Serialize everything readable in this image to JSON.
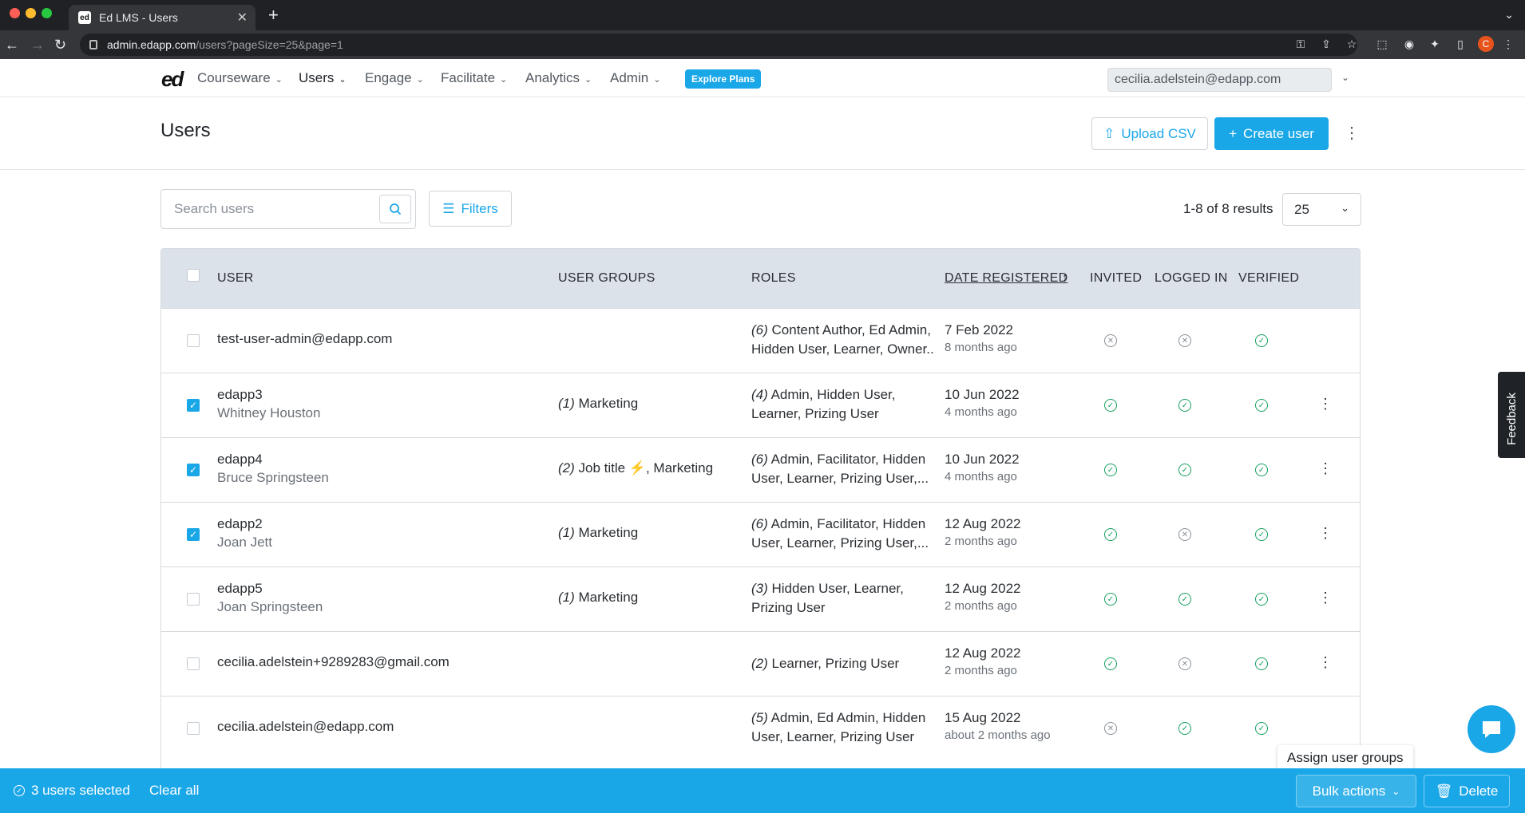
{
  "browser": {
    "tab_title": "Ed LMS - Users",
    "tab_favicon": "ed",
    "url_domain": "admin.edapp.com",
    "url_path": "/users?pageSize=25&page=1",
    "profile_initial": "C"
  },
  "nav": {
    "logo": "ed",
    "items": [
      {
        "label": "Courseware"
      },
      {
        "label": "Users"
      },
      {
        "label": "Engage"
      },
      {
        "label": "Facilitate"
      },
      {
        "label": "Analytics"
      },
      {
        "label": "Admin"
      }
    ],
    "explore_label": "Explore Plans",
    "account": "cecilia.adelstein@edapp.com"
  },
  "header": {
    "title": "Users",
    "upload_label": "Upload CSV",
    "create_label": "Create user"
  },
  "toolbar": {
    "search_placeholder": "Search users",
    "filters_label": "Filters",
    "results": "1-8 of 8 results",
    "page_size": "25"
  },
  "table": {
    "columns": [
      "USER",
      "USER GROUPS",
      "ROLES",
      "DATE REGISTERED",
      "INVITED",
      "LOGGED IN",
      "VERIFIED"
    ],
    "sort_arrow": "↑",
    "rows": [
      {
        "checked": false,
        "user": "test-user-admin@edapp.com",
        "name": "",
        "groups_count": "",
        "groups": "",
        "roles_count": "(6)",
        "roles_l1": " Content Author, Ed Admin,",
        "roles_l2": "Hidden User, Learner, Owner...",
        "date": "7 Feb 2022",
        "ago": "8 months ago",
        "invited": false,
        "logged_in": false,
        "verified": true,
        "menu": false
      },
      {
        "checked": true,
        "user": "edapp3",
        "name": "Whitney Houston",
        "groups_count": "(1)",
        "groups": " Marketing",
        "roles_count": "(4)",
        "roles_l1": " Admin, Hidden User,",
        "roles_l2": "Learner, Prizing User",
        "date": "10 Jun 2022",
        "ago": "4 months ago",
        "invited": true,
        "logged_in": true,
        "verified": true,
        "menu": true
      },
      {
        "checked": true,
        "user": "edapp4",
        "name": "Bruce Springsteen",
        "groups_count": "(2)",
        "groups": " Job title ⚡, Marketing",
        "roles_count": "(6)",
        "roles_l1": " Admin, Facilitator, Hidden",
        "roles_l2": "User, Learner, Prizing User,...",
        "date": "10 Jun 2022",
        "ago": "4 months ago",
        "invited": true,
        "logged_in": true,
        "verified": true,
        "menu": true
      },
      {
        "checked": true,
        "user": "edapp2",
        "name": "Joan Jett",
        "groups_count": "(1)",
        "groups": " Marketing",
        "roles_count": "(6)",
        "roles_l1": " Admin, Facilitator, Hidden",
        "roles_l2": "User, Learner, Prizing User,...",
        "date": "12 Aug 2022",
        "ago": "2 months ago",
        "invited": true,
        "logged_in": false,
        "verified": true,
        "menu": true
      },
      {
        "checked": false,
        "user": "edapp5",
        "name": "Joan Springsteen",
        "groups_count": "(1)",
        "groups": " Marketing",
        "roles_count": "(3)",
        "roles_l1": " Hidden User, Learner,",
        "roles_l2": "Prizing User",
        "date": "12 Aug 2022",
        "ago": "2 months ago",
        "invited": true,
        "logged_in": true,
        "verified": true,
        "menu": true
      },
      {
        "checked": false,
        "user": "cecilia.adelstein+9289283@gmail.com",
        "name": "",
        "groups_count": "",
        "groups": "",
        "roles_count": "(2)",
        "roles_l1": " Learner, Prizing User",
        "roles_l2": "",
        "date": "12 Aug 2022",
        "ago": "2 months ago",
        "invited": true,
        "logged_in": false,
        "verified": true,
        "menu": true
      },
      {
        "checked": false,
        "user": "cecilia.adelstein@edapp.com",
        "name": "",
        "groups_count": "",
        "groups": "",
        "roles_count": "(5)",
        "roles_l1": " Admin, Ed Admin, Hidden",
        "roles_l2": "User, Learner, Prizing User",
        "date": "15 Aug 2022",
        "ago": "about 2 months ago",
        "invited": false,
        "logged_in": true,
        "verified": true,
        "menu": false
      }
    ]
  },
  "bottom": {
    "selected": "3 users selected",
    "clear": "Clear all",
    "bulk": "Bulk actions",
    "delete": "Delete",
    "tooltip": "Assign user groups"
  },
  "feedback": "Feedback",
  "colors": {
    "accent": "#1aa7e8",
    "success": "#14a05c",
    "header_bg": "#dbe2ea"
  }
}
